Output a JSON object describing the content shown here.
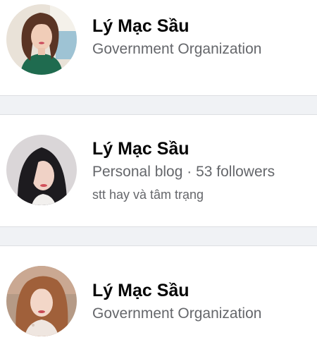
{
  "results": [
    {
      "name": "Lý Mạc Sầu",
      "category": "Government Organization",
      "avatar_icon": "profile-photo-avatar"
    },
    {
      "name": "Lý Mạc Sầu",
      "category": "Personal blog · 53 followers",
      "description": "stt hay và tâm trạng",
      "avatar_icon": "profile-photo-avatar"
    },
    {
      "name": "Lý Mạc Sầu",
      "category": "Government Organization",
      "avatar_icon": "profile-photo-avatar"
    }
  ],
  "colors": {
    "name": "#050505",
    "secondary_text": "#65676b",
    "background": "#f0f2f5",
    "card": "#ffffff"
  }
}
